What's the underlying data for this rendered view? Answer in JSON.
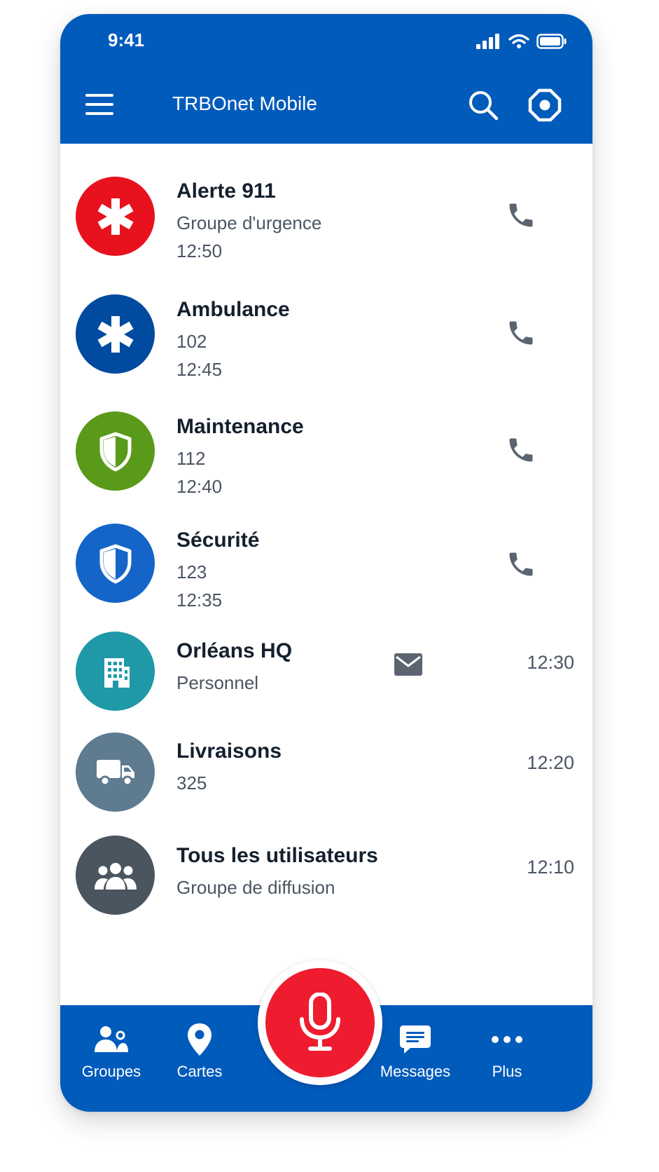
{
  "status_bar": {
    "time": "9:41"
  },
  "header": {
    "title": "TRBOnet Mobile"
  },
  "contacts": [
    {
      "name": "Alerte 911",
      "line1": "Groupe d'urgence",
      "line2": "12:50",
      "icon": "asterisk-icon",
      "color": "#e8121f"
    },
    {
      "name": "Ambulance",
      "line1": "102",
      "line2": "12:45",
      "icon": "asterisk-icon",
      "color": "#004a9f"
    },
    {
      "name": "Maintenance",
      "line1": "112",
      "line2": "12:40",
      "icon": "shield-icon",
      "color": "#5a9a1a"
    },
    {
      "name": "Sécurité",
      "line1": "123",
      "line2": "12:35",
      "icon": "shield-icon",
      "color": "#1565c8"
    },
    {
      "name": "Orléans HQ",
      "line1": "Personnel",
      "time": "12:30",
      "icon": "building-icon",
      "color": "#1f98a8"
    },
    {
      "name": "Livraisons",
      "line1": "325",
      "time": "12:20",
      "icon": "truck-icon",
      "color": "#5e7b90"
    },
    {
      "name": "Tous les utilisateurs",
      "line1": "Groupe de diffusion",
      "time": "12:10",
      "icon": "group-icon",
      "color": "#4a5560"
    }
  ],
  "bottom_nav": {
    "groups": "Groupes",
    "maps": "Cartes",
    "messages": "Messages",
    "more": "Plus"
  },
  "colors": {
    "brand": "#005bbb",
    "ptt": "#ee1c2e"
  }
}
